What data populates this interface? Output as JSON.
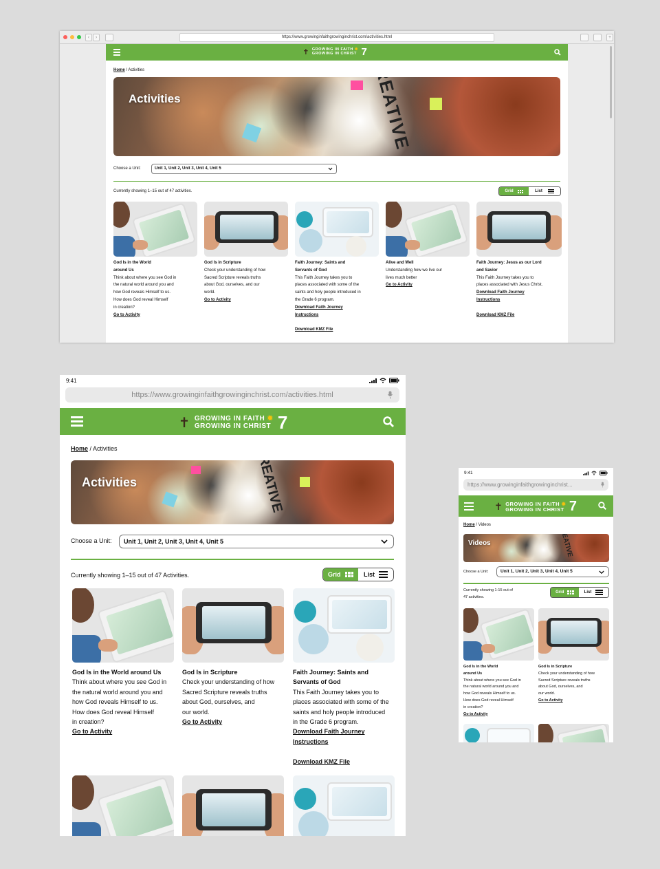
{
  "url": "https://www.growinginfaithgrowinginchrist.com/activities.html",
  "url_truncated": "https://www.growinginfaithgrowinginchrist...",
  "status_time": "9:41",
  "logo": {
    "line1": "GROWING IN FAITH",
    "line2": "GROWING IN CHRIST",
    "grade": "7"
  },
  "breadcrumb": {
    "home": "Home",
    "activities": "/ Activities",
    "videos": "/ Videos"
  },
  "banner": {
    "activities": "Activities",
    "videos": "Videos",
    "sticky_text": "CREATIVE"
  },
  "filter": {
    "label": "Choose a Unit:",
    "value": "Unit 1, Unit 2, Unit 3, Unit 4, Unit 5"
  },
  "showing": {
    "desktop": "Currently showing 1–15 out of 47 activities.",
    "tablet": "Currently showing 1–15 out of 47 Activities.",
    "phone_l1": "Currently showing 1-15 out of",
    "phone_l2": "47 activities."
  },
  "view_toggle": {
    "grid": "Grid",
    "list": "List"
  },
  "links": {
    "go": "Go to Activity",
    "download_fj": "Download Faith Journey",
    "download_fj2": "Instructions",
    "download_kmz": "Download KMZ File"
  },
  "cards": {
    "c1": {
      "title1": "God Is in the World",
      "title2": "around Us",
      "title_full": "God Is in the World around Us",
      "d1": "Think about where you see God in",
      "d2": "the natural world around you and",
      "d3": "how God reveals Himself to us.",
      "d4": "How does God reveal Himself",
      "d5": "in creation?"
    },
    "c2": {
      "title": "God Is in Scripture",
      "d1": "Check your understanding of how",
      "d2": "Sacred Scripture reveals truths",
      "d3": "about God, ourselves, and our",
      "d4": "world.",
      "t_d3": "about God, ourselves, and",
      "t_d4": "our world."
    },
    "c3": {
      "title1": "Faith Journey: Saints and",
      "title2": "Servants of God",
      "d1": "This Faith Journey takes you to",
      "d2": "places associated with some of the",
      "d3": "saints and holy people introduced in",
      "d4": "the Grade 6 program.",
      "t_d3": "saints and holy people introduced",
      "t_d4": "in the Grade 6 program."
    },
    "c4": {
      "title": "Alive and Well",
      "d1": "Understanding how we live our",
      "d2": "lives much better"
    },
    "c5": {
      "title1": "Faith Journey: Jesus as our Lord",
      "title2": "and Savior",
      "d1": "This Faith Journey takes you to",
      "d2": "places associated with Jesus Christ."
    }
  },
  "colors": {
    "brand_green": "#6ab042",
    "background": "#dcdcdc"
  },
  "icons": [
    "hamburger-icon",
    "search-icon",
    "chevron-down-icon",
    "grid-icon",
    "list-icon",
    "mic-icon",
    "signal-icon",
    "wifi-icon",
    "battery-icon",
    "cross-logo-icon",
    "sunflower-icon"
  ]
}
